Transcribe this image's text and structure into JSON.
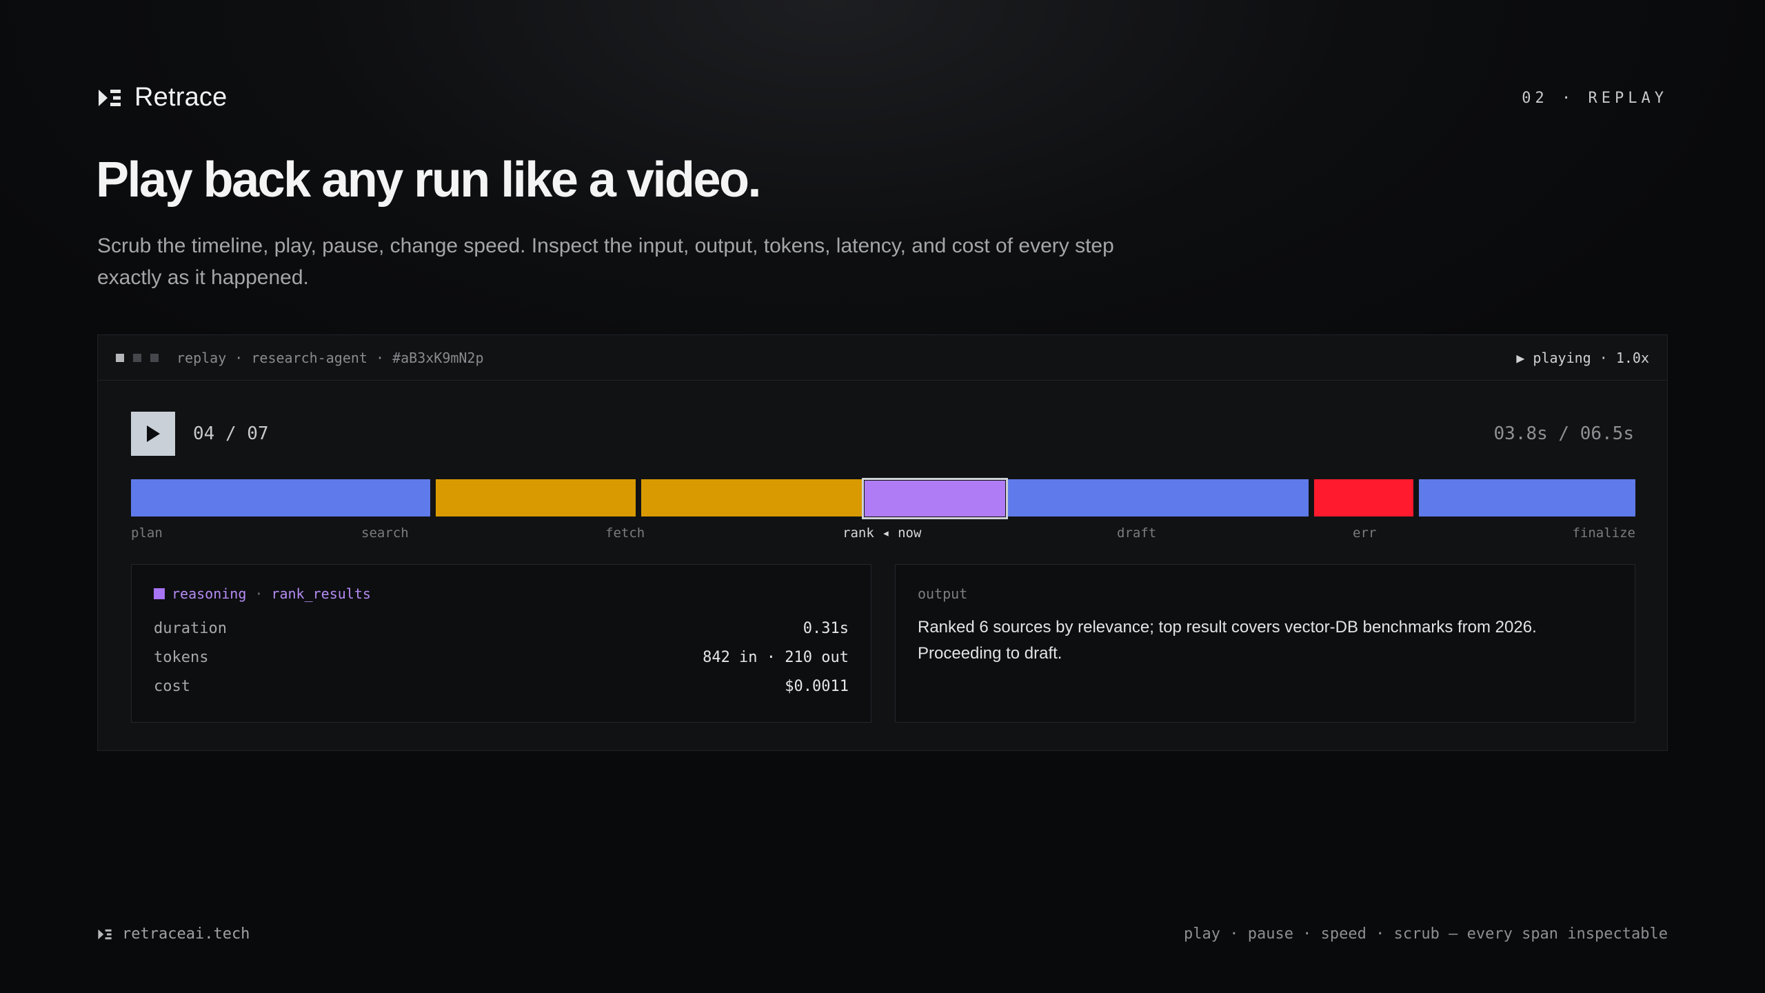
{
  "brand": {
    "name": "Retrace",
    "icon": "retrace-logo-icon"
  },
  "section_tag": "02 · REPLAY",
  "headline": "Play back any run like a video.",
  "subtitle": "Scrub the timeline, play, pause, change speed. Inspect the input, output, tokens, latency, and cost of every step exactly as it happened.",
  "panel": {
    "title": "replay · research-agent · #aB3xK9mN2p",
    "status": "▶ playing · 1.0x",
    "step_counter": "04 / 07",
    "time_counter": "03.8s / 06.5s",
    "play_icon": "play-icon",
    "colors": {
      "reasoning": "#a774f4",
      "retrieval": "#d89a00",
      "llm": "#5f7aea",
      "error": "#ff1a2e"
    },
    "segments": [
      {
        "color": "#5f7aea",
        "current": false
      },
      {
        "color": "#d89a00",
        "current": false
      },
      {
        "color": "#d89a00",
        "current": false
      },
      {
        "color": "#b07cf6",
        "current": true
      },
      {
        "color": "#5f7aea",
        "current": false
      },
      {
        "color": "#ff1a2e",
        "current": false
      },
      {
        "color": "#5f7aea",
        "current": false
      }
    ],
    "labels": {
      "plan": "plan",
      "search": "search",
      "fetch": "fetch",
      "rank": "rank ◂ now",
      "draft": "draft",
      "err": "err",
      "finalize": "finalize"
    },
    "detail": {
      "kind": "reasoning",
      "step": "rank_results",
      "duration_label": "duration",
      "duration": "0.31s",
      "tokens_label": "tokens",
      "tokens": "842 in · 210 out",
      "cost_label": "cost",
      "cost": "$0.0011"
    },
    "output": {
      "label": "output",
      "text": "Ranked 6 sources by relevance; top result covers vector-DB benchmarks from 2026. Proceeding to draft."
    }
  },
  "footer": {
    "site": "retraceai.tech",
    "tagline": "play · pause · speed · scrub — every span inspectable"
  }
}
